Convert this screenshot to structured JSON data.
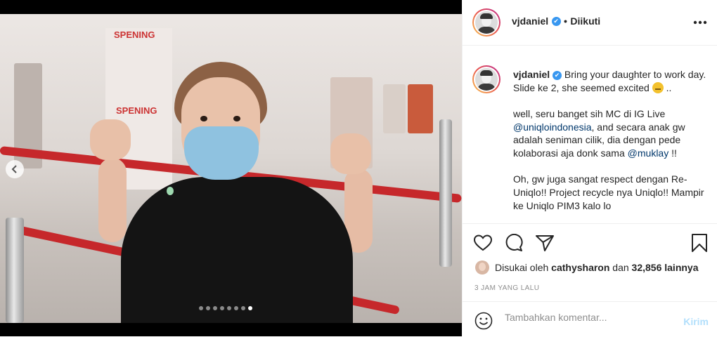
{
  "post": {
    "carousel": {
      "dot_count": 8,
      "active_index": 7
    }
  },
  "header": {
    "username": "vjdaniel",
    "verified": "✔",
    "separator": "•",
    "follow_label": "Diikuti",
    "more_icon": "more-horizontal-icon"
  },
  "caption": {
    "username": "vjdaniel",
    "line1": "Bring your daughter to work day. Slide ke 2, she seemed excited",
    "line1_after_emoji": "..",
    "p2_a": "well, seru banget sih MC di IG Live",
    "p2_mention1": "@uniqloindonesia",
    "p2_b": ", and secara anak gw adalah seniman cilik, dia dengan pede kolaborasi aja donk sama",
    "p2_mention2": "@muklay",
    "p2_c": "!!",
    "p3": "Oh, gw juga sangat respect dengan Re-Uniqlo!! Project recycle nya Uniqlo!! Mampir ke Uniqlo PIM3 kalo lo"
  },
  "actions": {
    "like_icon": "heart-icon",
    "comment_icon": "comment-icon",
    "share_icon": "send-icon",
    "save_icon": "bookmark-icon"
  },
  "likes": {
    "prefix": "Disukai oleh",
    "liker": "cathysharon",
    "middle": "dan",
    "count": "32,856 lainnya"
  },
  "timestamp": "3 JAM YANG LALU",
  "comment": {
    "placeholder": "Tambahkan komentar...",
    "post_label": "Kirim"
  },
  "colors": {
    "link": "#00376b",
    "verified": "#3897f0",
    "post_disabled": "#b2dffc",
    "rope": "#c6282b"
  },
  "photo_sign": {
    "text1": "SPENING",
    "text2": "SPENING"
  }
}
